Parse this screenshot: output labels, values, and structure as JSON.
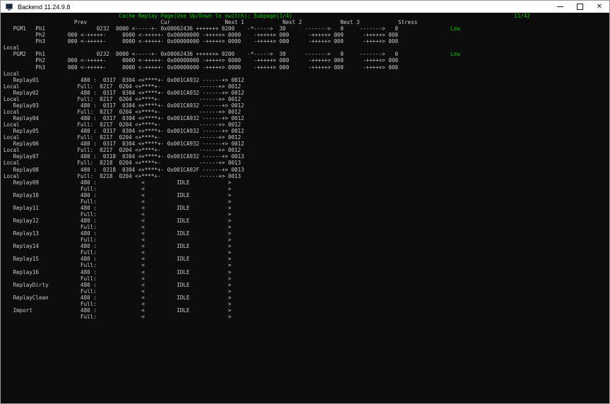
{
  "window": {
    "title": "Backend 11.24.9.8",
    "controls": {
      "minimize": "minimize",
      "maximize": "maximize",
      "close": "close"
    }
  },
  "console": {
    "header": "                                    Cache Replay Page(Use Up/Down to switch): Subpage(1/4)",
    "page_counter": "11/42",
    "lines": [
      "                      Prev                       Cur                 Next 1            Next 2            Next 3            Stress",
      "   PGM1   Ph1                0232  0000 <-----+- 0x00002436 ++++++> 0200    -*----->  30      ------->   0     ------->   0",
      "          Ph2       000 <-+++++-     0000 <-+++++- 0x00000000 -+++++> 0000    -+++++> 000      -+++++> 000      -+++++> 000",
      "          Ph3       000 <-+++++-     0000 <-+++++- 0x00000000 -+++++> 0000    -+++++> 000      -+++++> 000      -+++++> 000",
      "Local",
      "   PGM2   Ph1                0232  0000 <-----+- 0x00002436 ++++++> 0200    -*----->  30      ------->   0     ------->   0",
      "          Ph2       000 <-+++++-     0000 <-+++++- 0x00000000 -+++++> 0000    -+++++> 000      -+++++> 000      -+++++> 000",
      "          Ph3       000 <-+++++-     0000 <-+++++- 0x00000000 -+++++> 0000    -+++++> 000      -+++++> 000      -+++++> 000",
      "Local",
      "   Replay01             480 :  0317  0304 <+****+- 0x001CA932 ------+> 0012",
      "Local                  Full:  0217  0204 <+****+-            ------+> 0012",
      "   Replay02             480 :  0317  0304 <+****+- 0x001CA932 ------+> 0012",
      "Local                  Full:  0217  0204 <+****+-            ------+> 0012",
      "   Replay03             480 :  0317  0304 <+****+- 0x001CA932 ------+> 0012",
      "Local                  Full:  0217  0204 <+****+-            ------+> 0012",
      "   Replay04             480 :  0317  0304 <+****+- 0x001CA932 ------+> 0012",
      "Local                  Full:  0217  0204 <+****+-            ------+> 0012",
      "   Replay05             480 :  0317  0304 <+****+- 0x001CA932 ------+> 0012",
      "Local                  Full:  0217  0204 <+****+-            ------+> 0012",
      "   Replay06             480 :  0317  0304 <+****+- 0x001CA932 ------+> 0012",
      "Local                  Full:  0217  0204 <+****+-            ------+> 0012",
      "   Replay07             480 :  0318  0304 <+****+- 0x001CA932 ------+> 0013",
      "Local                  Full:  0218  0204 <+****+-            ------+> 0013",
      "   Replay08             480 :  0318  0304 <+****+- 0x001CA92F ------+> 0013",
      "Local                  Full:  0218  0204 <+****+-            ------+> 0013",
      "   Replay09             480 :              <          IDLE            >",
      "                        Full:              <                          >",
      "   Replay10             480 :              <          IDLE            >",
      "                        Full:              <                          >",
      "   Replay11             480 :              <          IDLE            >",
      "                        Full:              <                          >",
      "   Replay12             480 :              <          IDLE            >",
      "                        Full:              <                          >",
      "   Replay13             480 :              <          IDLE            >",
      "                        Full:              <                          >",
      "   Replay14             480 :              <          IDLE            >",
      "                        Full:              <                          >",
      "   Replay15             480 :              <          IDLE            >",
      "                        Full:              <                          >",
      "   Replay16             480 :              <          IDLE            >",
      "                        Full:              <                          >",
      "   ReplayDirty          480 :              <          IDLE            >",
      "                        Full:              <                          >",
      "   ReplayClean          480 :              <          IDLE            >",
      "                        Full:              <                          >",
      "   Import               480 :              <          IDLE            >",
      "                        Full:              <                          >"
    ],
    "stress_pgm1": "Low",
    "stress_pgm2": "Low"
  },
  "colors": {
    "background": "#0c0c0c",
    "text": "#cccccc",
    "accent_green": "#16c60c"
  },
  "icons": {
    "app": "console-app-icon"
  }
}
